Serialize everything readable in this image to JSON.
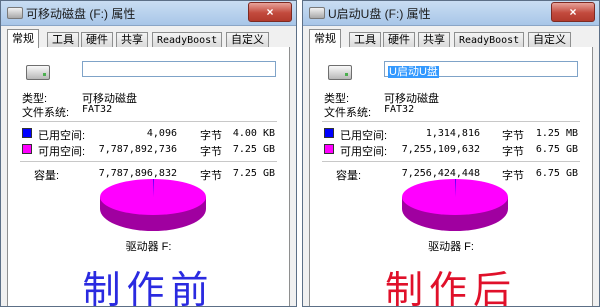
{
  "colors": {
    "used": "#0000ff",
    "free": "#ff00ff",
    "caption_before": "#2a2ae0",
    "caption_after": "#e0102a"
  },
  "dialogs": [
    {
      "title": "可移动磁盘 (F:) 属性",
      "close": "×",
      "tabs": [
        "常规",
        "工具",
        "硬件",
        "共享",
        "ReadyBoost",
        "自定义"
      ],
      "name_value": "",
      "type_label": "类型:",
      "type_value": "可移动磁盘",
      "fs_label": "文件系统:",
      "fs_value": "FAT32",
      "used_label": "已用空间:",
      "used_bytes": "4,096",
      "used_unit": "字节",
      "used_size": "4.00 KB",
      "free_label": "可用空间:",
      "free_bytes": "7,787,892,736",
      "free_unit": "字节",
      "free_size": "7.25 GB",
      "cap_label": "容量:",
      "cap_bytes": "7,787,896,832",
      "cap_unit": "字节",
      "cap_size": "7.25 GB",
      "used_fraction": 5e-07,
      "drive_label": "驱动器 F:",
      "caption": "制作前"
    },
    {
      "title": "U启动U盘 (F:) 属性",
      "close": "×",
      "tabs": [
        "常规",
        "工具",
        "硬件",
        "共享",
        "ReadyBoost",
        "自定义"
      ],
      "name_value": "U启动U盘",
      "type_label": "类型:",
      "type_value": "可移动磁盘",
      "fs_label": "文件系统:",
      "fs_value": "FAT32",
      "used_label": "已用空间:",
      "used_bytes": "1,314,816",
      "used_unit": "字节",
      "used_size": "1.25 MB",
      "free_label": "可用空间:",
      "free_bytes": "7,255,109,632",
      "free_unit": "字节",
      "free_size": "6.75 GB",
      "cap_label": "容量:",
      "cap_bytes": "7,256,424,448",
      "cap_unit": "字节",
      "cap_size": "6.75 GB",
      "used_fraction": 0.00018,
      "drive_label": "驱动器 F:",
      "caption": "制作后"
    }
  ]
}
